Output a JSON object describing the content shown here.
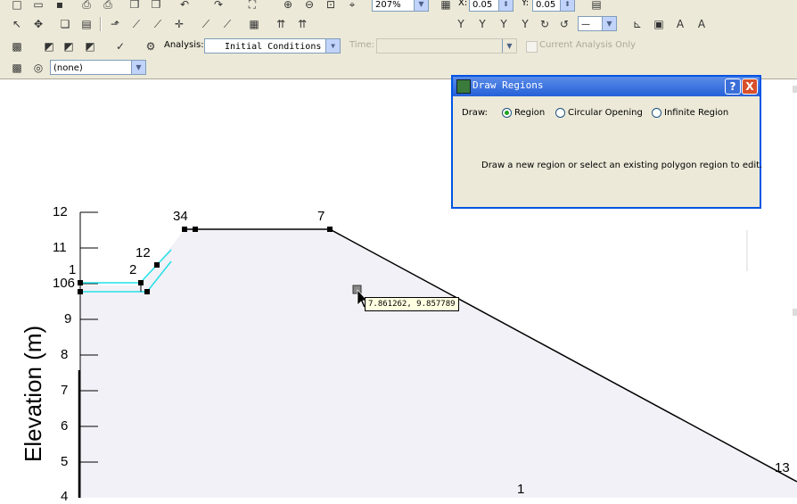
{
  "toolbar": {
    "zoom_value": "207%",
    "x_snap_label": "X:",
    "x_snap_value": "0.05",
    "y_snap_label": "Y:",
    "y_snap_value": "0.05",
    "analysis_label": "Analysis:",
    "analysis_value": "Initial Conditions",
    "time_label": "Time:",
    "current_only_label": "Current Analysis Only",
    "filter_value": "(none)",
    "text_tool": "A"
  },
  "dialog": {
    "title": "Draw Regions",
    "help": "?",
    "close": "X",
    "draw_label": "Draw:",
    "options": [
      "Region",
      "Circular Opening",
      "Infinite Region"
    ],
    "selected_option": "Region",
    "instruction": "Draw a new region or select an existing polygon region to edit."
  },
  "canvas": {
    "cursor_coord": "7.861262, 9.857789",
    "y_axis_title": "Elevation (m)",
    "y_ticks": [
      "12",
      "11",
      "10",
      "9",
      "8",
      "7",
      "6",
      "5",
      "4"
    ],
    "point_labels": {
      "p34": "34",
      "p7": "7",
      "p12": "12",
      "p1": "1",
      "p2": "2",
      "p106": "106",
      "p13": "13",
      "region": "1"
    }
  },
  "colors": {
    "selection_line": "#22e0e8",
    "titlebar": "#2560d8",
    "region_fill": "#f2f1f7"
  }
}
